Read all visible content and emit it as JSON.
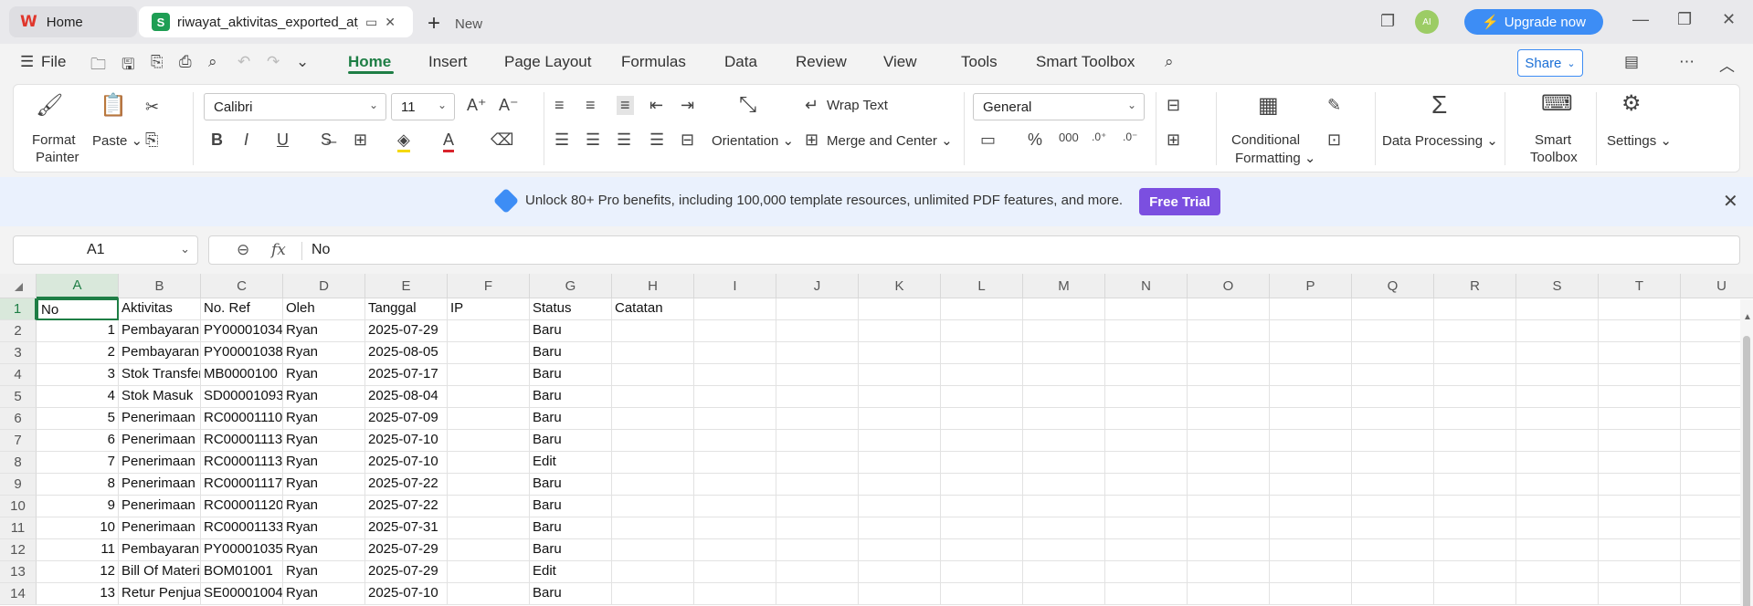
{
  "titlebar": {
    "home_tab": "Home",
    "file_tab": "riwayat_aktivitas_exported_at_",
    "new_tab": "New",
    "avatar": "AI",
    "upgrade": "Upgrade now"
  },
  "menu": {
    "file": "File",
    "items": [
      "Home",
      "Insert",
      "Page Layout",
      "Formulas",
      "Data",
      "Review",
      "View",
      "Tools",
      "Smart Toolbox"
    ],
    "share": "Share"
  },
  "ribbon": {
    "format_painter_1": "Format",
    "format_painter_2": "Painter",
    "paste": "Paste",
    "font": "Calibri",
    "font_size": "11",
    "wrap_text": "Wrap Text",
    "orientation": "Orientation",
    "merge_center": "Merge and Center",
    "number_format": "General",
    "conditional_1": "Conditional",
    "conditional_2": "Formatting",
    "data_processing": "Data Processing",
    "smart_toolbox_1": "Smart",
    "smart_toolbox_2": "Toolbox",
    "settings": "Settings"
  },
  "promo": {
    "text": "Unlock 80+ Pro benefits, including 100,000 template resources, unlimited PDF features, and more.",
    "button": "Free Trial"
  },
  "formula_bar": {
    "name_box": "A1",
    "fx": "fx",
    "content": "No"
  },
  "sheet": {
    "columns": [
      "A",
      "B",
      "C",
      "D",
      "E",
      "F",
      "G",
      "H",
      "I",
      "J",
      "K",
      "L",
      "M",
      "N",
      "O",
      "P",
      "Q",
      "R",
      "S",
      "T",
      "U"
    ],
    "rows": [
      [
        "No",
        "Aktivitas",
        "No. Ref",
        "Oleh",
        "Tanggal",
        "IP",
        "Status",
        "Catatan"
      ],
      [
        "1",
        "Pembayaran",
        "PY00001034",
        "Ryan",
        "2025-07-29",
        "",
        "Baru",
        ""
      ],
      [
        "2",
        "Pembayaran",
        "PY00001038",
        "Ryan",
        "2025-08-05",
        "",
        "Baru",
        ""
      ],
      [
        "3",
        "Stok Transfer",
        "MB0000100",
        "Ryan",
        "2025-07-17",
        "",
        "Baru",
        ""
      ],
      [
        "4",
        "Stok Masuk",
        "SD00001093",
        "Ryan",
        "2025-08-04",
        "",
        "Baru",
        ""
      ],
      [
        "5",
        "Penerimaan",
        "RC00001110",
        "Ryan",
        "2025-07-09",
        "",
        "Baru",
        ""
      ],
      [
        "6",
        "Penerimaan",
        "RC00001113",
        "Ryan",
        "2025-07-10",
        "",
        "Baru",
        ""
      ],
      [
        "7",
        "Penerimaan",
        "RC00001113",
        "Ryan",
        "2025-07-10",
        "",
        "Edit",
        ""
      ],
      [
        "8",
        "Penerimaan",
        "RC00001117",
        "Ryan",
        "2025-07-22",
        "",
        "Baru",
        ""
      ],
      [
        "9",
        "Penerimaan",
        "RC00001120",
        "Ryan",
        "2025-07-22",
        "",
        "Baru",
        ""
      ],
      [
        "10",
        "Penerimaan",
        "RC00001133",
        "Ryan",
        "2025-07-31",
        "",
        "Baru",
        ""
      ],
      [
        "11",
        "Pembayaran",
        "PY00001035",
        "Ryan",
        "2025-07-29",
        "",
        "Baru",
        ""
      ],
      [
        "12",
        "Bill Of Material",
        "BOM01001",
        "Ryan",
        "2025-07-29",
        "",
        "Edit",
        ""
      ],
      [
        "13",
        "Retur Penjualan",
        "SE00001004",
        "Ryan",
        "2025-07-10",
        "",
        "Baru",
        ""
      ]
    ]
  }
}
